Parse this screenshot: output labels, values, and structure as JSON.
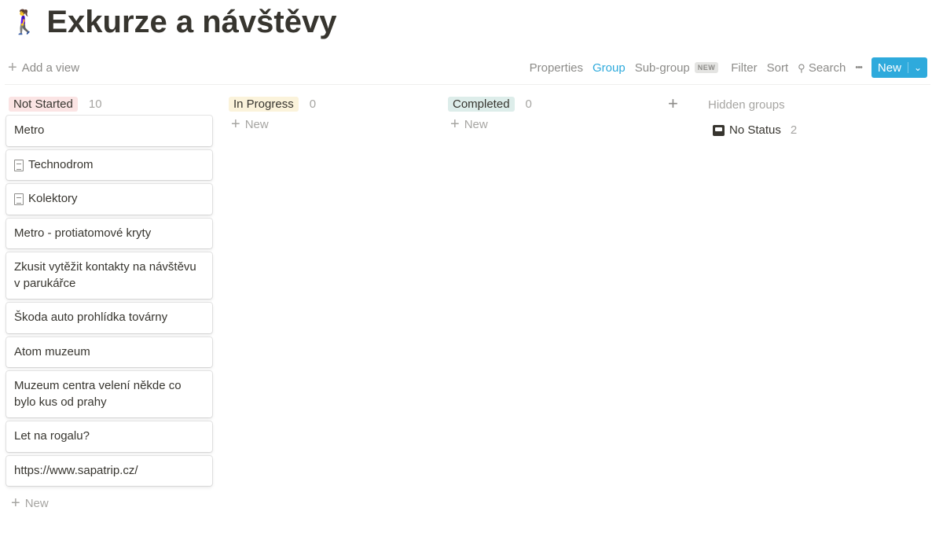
{
  "page": {
    "emoji": "🚶‍♀️",
    "title": "Exkurze a návštěvy"
  },
  "toolbar": {
    "add_view": "Add a view",
    "properties": "Properties",
    "group": "Group",
    "subgroup": "Sub-group",
    "new_badge": "NEW",
    "filter": "Filter",
    "sort": "Sort",
    "search": "Search",
    "more": "•••",
    "new": "New",
    "accent": "#2eaadc"
  },
  "columns": [
    {
      "label": "Not Started",
      "count": "10",
      "color": "#fbe4e4",
      "cards": [
        "Metro",
        "Technodrom",
        "Kolektory",
        "Metro - protiatomové kryty",
        "Zkusit vytěžit kontakty na návštěvu v parukářce",
        "Škoda auto prohlídka továrny",
        "Atom muzeum",
        "Muzeum centra velení někde co bylo kus od prahy",
        "Let na rogalu?",
        "https://www.sapatrip.cz/"
      ],
      "new": "New"
    },
    {
      "label": "In Progress",
      "count": "0",
      "color": "#fbf3db",
      "new": "New"
    },
    {
      "label": "Completed",
      "count": "0",
      "color": "#ddedea",
      "new": "New"
    }
  ],
  "hidden": {
    "label": "Hidden groups",
    "no_status": "No Status",
    "no_status_count": "2"
  }
}
